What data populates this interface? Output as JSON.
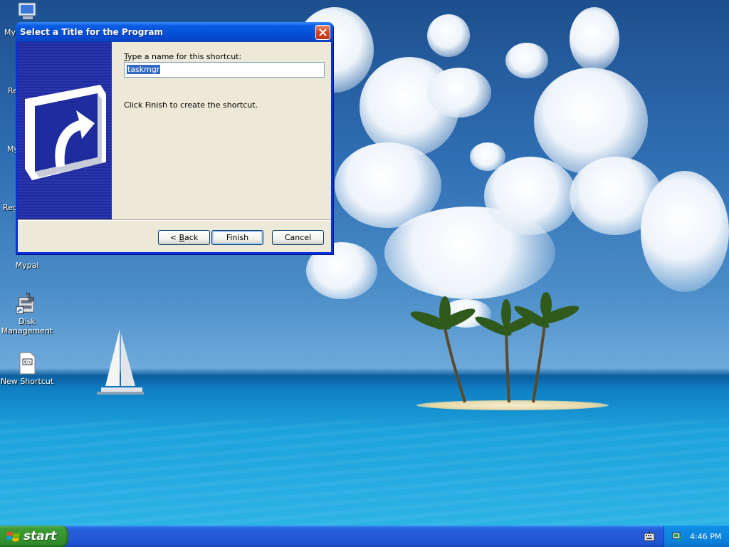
{
  "dialog": {
    "title": "Select a Title for the Program",
    "prompt_prefix": "",
    "prompt_mnemonic": "T",
    "prompt_rest": "ype a name for this shortcut:",
    "name_value": "taskmgr",
    "hint": "Click Finish to create the shortcut.",
    "back_mnemonic_prefix": "< ",
    "back_mnemonic": "B",
    "back_rest": "ack",
    "finish_label": "Finish",
    "cancel_label": "Cancel"
  },
  "desktop": {
    "partial_labels": [
      "My",
      "Re",
      "My",
      "Reg"
    ],
    "icons": [
      {
        "label": "Mypal",
        "icon": "mypal-icon"
      },
      {
        "label": "Disk\nManagement",
        "icon": "disk-management-icon"
      },
      {
        "label": "New Shortcut",
        "icon": "shortcut-file-icon"
      }
    ]
  },
  "taskbar": {
    "start_label": "start",
    "clock": "4:46 PM"
  }
}
